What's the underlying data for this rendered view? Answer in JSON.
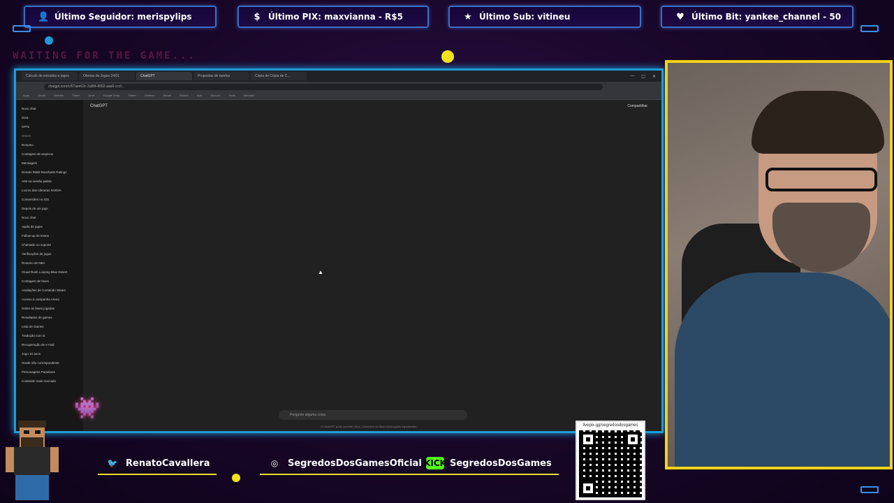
{
  "alerts": [
    {
      "icon": "person-icon",
      "glyph": "👤",
      "text": "Último Seguidor: merispylips"
    },
    {
      "icon": "dollar-icon",
      "glyph": "$",
      "text": "Último PIX: maxvianna - R$5"
    },
    {
      "icon": "star-icon",
      "glyph": "★",
      "text": "Último Sub: vitineu"
    },
    {
      "icon": "heart-icon",
      "glyph": "♥",
      "text": "Último Bit: yankee_channel - 50"
    }
  ],
  "overlay": {
    "waiting_text": "WAITING FOR THE GAME..."
  },
  "browser": {
    "tabs": [
      "Cálculo de estradas e jogos",
      "Ofertas de Jogos 24/01",
      "ChatGPT",
      "Propostas de tarefas",
      "Cópia de Cópia de C..."
    ],
    "address": "chatgpt.com/c/67aee62c-2a8f4-8002-aaa6-cccf...",
    "bookmarks": [
      "Apps",
      "Gmail",
      "Youtube",
      "Twitch",
      "Drive",
      "Google Keep",
      "Twitter",
      "Amazon",
      "Steam",
      "Roblox",
      "Epic",
      "Discord",
      "Trello",
      "Mercado"
    ]
  },
  "chatgpt": {
    "model": "ChatGPT",
    "share": "Compartilhar",
    "sidebar": [
      {
        "label": "Novo chat",
        "head": false
      },
      {
        "label": "Sora",
        "head": false
      },
      {
        "label": "GPTs",
        "head": false
      },
      {
        "label": "Ontem",
        "head": true
      },
      {
        "label": "Resumo",
        "head": false
      },
      {
        "label": "Contagem de arquivos",
        "head": false
      },
      {
        "label": "Mensagem",
        "head": false
      },
      {
        "label": "Renato Rabit Reacharts Ratings",
        "head": false
      },
      {
        "label": "Arte na versão paleta",
        "head": false
      },
      {
        "label": "Lucros das câmeras NVIDIA",
        "head": false
      },
      {
        "label": "Conversões no iOS",
        "head": false
      },
      {
        "label": "Depois de um jogo",
        "head": false
      },
      {
        "label": "Novo chat",
        "head": false
      },
      {
        "label": "Ajuda de jogos",
        "head": false
      },
      {
        "label": "Follow-up de textos",
        "head": false
      },
      {
        "label": "Chamado no suporte",
        "head": false
      },
      {
        "label": "Verificações de jogos",
        "head": false
      },
      {
        "label": "Resumo de NBA",
        "head": false
      },
      {
        "label": "Cloud Rush Looping Blue Desert",
        "head": false
      },
      {
        "label": "Contagem de fases",
        "head": false
      },
      {
        "label": "Avaliações de Conteúdo Steam",
        "head": false
      },
      {
        "label": "Acesso à campanha Arena",
        "head": false
      },
      {
        "label": "Sobre as fases jogadas",
        "head": false
      },
      {
        "label": "Resultados de games",
        "head": false
      },
      {
        "label": "Lista de Games",
        "head": false
      },
      {
        "label": "Tradução com ia",
        "head": false
      },
      {
        "label": "Recuperação de e-mail",
        "head": false
      },
      {
        "label": "Jogo 10 anos",
        "head": false
      },
      {
        "label": "Grade não correspondente",
        "head": false
      },
      {
        "label": "Personagens Populares",
        "head": false
      },
      {
        "label": "Conteúdo mais marcado",
        "head": false
      }
    ],
    "prompt_placeholder": "Pergunte alguma coisa",
    "disclaimer": "O ChatGPT pode cometer erros. Considere verificar informações importantes."
  },
  "socials": [
    {
      "icon": "twitter-icon",
      "glyph": "🐦",
      "handle": "RenatoCavallera"
    },
    {
      "icon": "instagram-icon",
      "glyph": "◎",
      "handle": "SegredosDosGamesOficial"
    },
    {
      "icon": "kick-icon",
      "glyph": "KICK",
      "handle": "SegredosDosGames"
    }
  ],
  "qr": {
    "url": "livepix.gg/segredosdosgames"
  }
}
